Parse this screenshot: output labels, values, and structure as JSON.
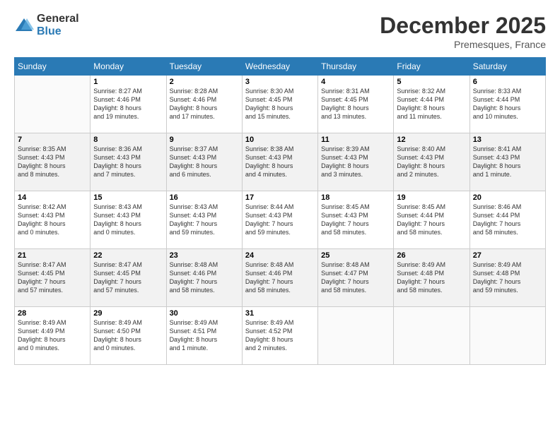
{
  "logo": {
    "general": "General",
    "blue": "Blue"
  },
  "header": {
    "month": "December 2025",
    "location": "Premesques, France"
  },
  "weekdays": [
    "Sunday",
    "Monday",
    "Tuesday",
    "Wednesday",
    "Thursday",
    "Friday",
    "Saturday"
  ],
  "weeks": [
    [
      {
        "day": "",
        "info": ""
      },
      {
        "day": "1",
        "info": "Sunrise: 8:27 AM\nSunset: 4:46 PM\nDaylight: 8 hours\nand 19 minutes."
      },
      {
        "day": "2",
        "info": "Sunrise: 8:28 AM\nSunset: 4:46 PM\nDaylight: 8 hours\nand 17 minutes."
      },
      {
        "day": "3",
        "info": "Sunrise: 8:30 AM\nSunset: 4:45 PM\nDaylight: 8 hours\nand 15 minutes."
      },
      {
        "day": "4",
        "info": "Sunrise: 8:31 AM\nSunset: 4:45 PM\nDaylight: 8 hours\nand 13 minutes."
      },
      {
        "day": "5",
        "info": "Sunrise: 8:32 AM\nSunset: 4:44 PM\nDaylight: 8 hours\nand 11 minutes."
      },
      {
        "day": "6",
        "info": "Sunrise: 8:33 AM\nSunset: 4:44 PM\nDaylight: 8 hours\nand 10 minutes."
      }
    ],
    [
      {
        "day": "7",
        "info": "Sunrise: 8:35 AM\nSunset: 4:43 PM\nDaylight: 8 hours\nand 8 minutes."
      },
      {
        "day": "8",
        "info": "Sunrise: 8:36 AM\nSunset: 4:43 PM\nDaylight: 8 hours\nand 7 minutes."
      },
      {
        "day": "9",
        "info": "Sunrise: 8:37 AM\nSunset: 4:43 PM\nDaylight: 8 hours\nand 6 minutes."
      },
      {
        "day": "10",
        "info": "Sunrise: 8:38 AM\nSunset: 4:43 PM\nDaylight: 8 hours\nand 4 minutes."
      },
      {
        "day": "11",
        "info": "Sunrise: 8:39 AM\nSunset: 4:43 PM\nDaylight: 8 hours\nand 3 minutes."
      },
      {
        "day": "12",
        "info": "Sunrise: 8:40 AM\nSunset: 4:43 PM\nDaylight: 8 hours\nand 2 minutes."
      },
      {
        "day": "13",
        "info": "Sunrise: 8:41 AM\nSunset: 4:43 PM\nDaylight: 8 hours\nand 1 minute."
      }
    ],
    [
      {
        "day": "14",
        "info": "Sunrise: 8:42 AM\nSunset: 4:43 PM\nDaylight: 8 hours\nand 0 minutes."
      },
      {
        "day": "15",
        "info": "Sunrise: 8:43 AM\nSunset: 4:43 PM\nDaylight: 8 hours\nand 0 minutes."
      },
      {
        "day": "16",
        "info": "Sunrise: 8:43 AM\nSunset: 4:43 PM\nDaylight: 7 hours\nand 59 minutes."
      },
      {
        "day": "17",
        "info": "Sunrise: 8:44 AM\nSunset: 4:43 PM\nDaylight: 7 hours\nand 59 minutes."
      },
      {
        "day": "18",
        "info": "Sunrise: 8:45 AM\nSunset: 4:43 PM\nDaylight: 7 hours\nand 58 minutes."
      },
      {
        "day": "19",
        "info": "Sunrise: 8:45 AM\nSunset: 4:44 PM\nDaylight: 7 hours\nand 58 minutes."
      },
      {
        "day": "20",
        "info": "Sunrise: 8:46 AM\nSunset: 4:44 PM\nDaylight: 7 hours\nand 58 minutes."
      }
    ],
    [
      {
        "day": "21",
        "info": "Sunrise: 8:47 AM\nSunset: 4:45 PM\nDaylight: 7 hours\nand 57 minutes."
      },
      {
        "day": "22",
        "info": "Sunrise: 8:47 AM\nSunset: 4:45 PM\nDaylight: 7 hours\nand 57 minutes."
      },
      {
        "day": "23",
        "info": "Sunrise: 8:48 AM\nSunset: 4:46 PM\nDaylight: 7 hours\nand 58 minutes."
      },
      {
        "day": "24",
        "info": "Sunrise: 8:48 AM\nSunset: 4:46 PM\nDaylight: 7 hours\nand 58 minutes."
      },
      {
        "day": "25",
        "info": "Sunrise: 8:48 AM\nSunset: 4:47 PM\nDaylight: 7 hours\nand 58 minutes."
      },
      {
        "day": "26",
        "info": "Sunrise: 8:49 AM\nSunset: 4:48 PM\nDaylight: 7 hours\nand 58 minutes."
      },
      {
        "day": "27",
        "info": "Sunrise: 8:49 AM\nSunset: 4:48 PM\nDaylight: 7 hours\nand 59 minutes."
      }
    ],
    [
      {
        "day": "28",
        "info": "Sunrise: 8:49 AM\nSunset: 4:49 PM\nDaylight: 8 hours\nand 0 minutes."
      },
      {
        "day": "29",
        "info": "Sunrise: 8:49 AM\nSunset: 4:50 PM\nDaylight: 8 hours\nand 0 minutes."
      },
      {
        "day": "30",
        "info": "Sunrise: 8:49 AM\nSunset: 4:51 PM\nDaylight: 8 hours\nand 1 minute."
      },
      {
        "day": "31",
        "info": "Sunrise: 8:49 AM\nSunset: 4:52 PM\nDaylight: 8 hours\nand 2 minutes."
      },
      {
        "day": "",
        "info": ""
      },
      {
        "day": "",
        "info": ""
      },
      {
        "day": "",
        "info": ""
      }
    ]
  ]
}
